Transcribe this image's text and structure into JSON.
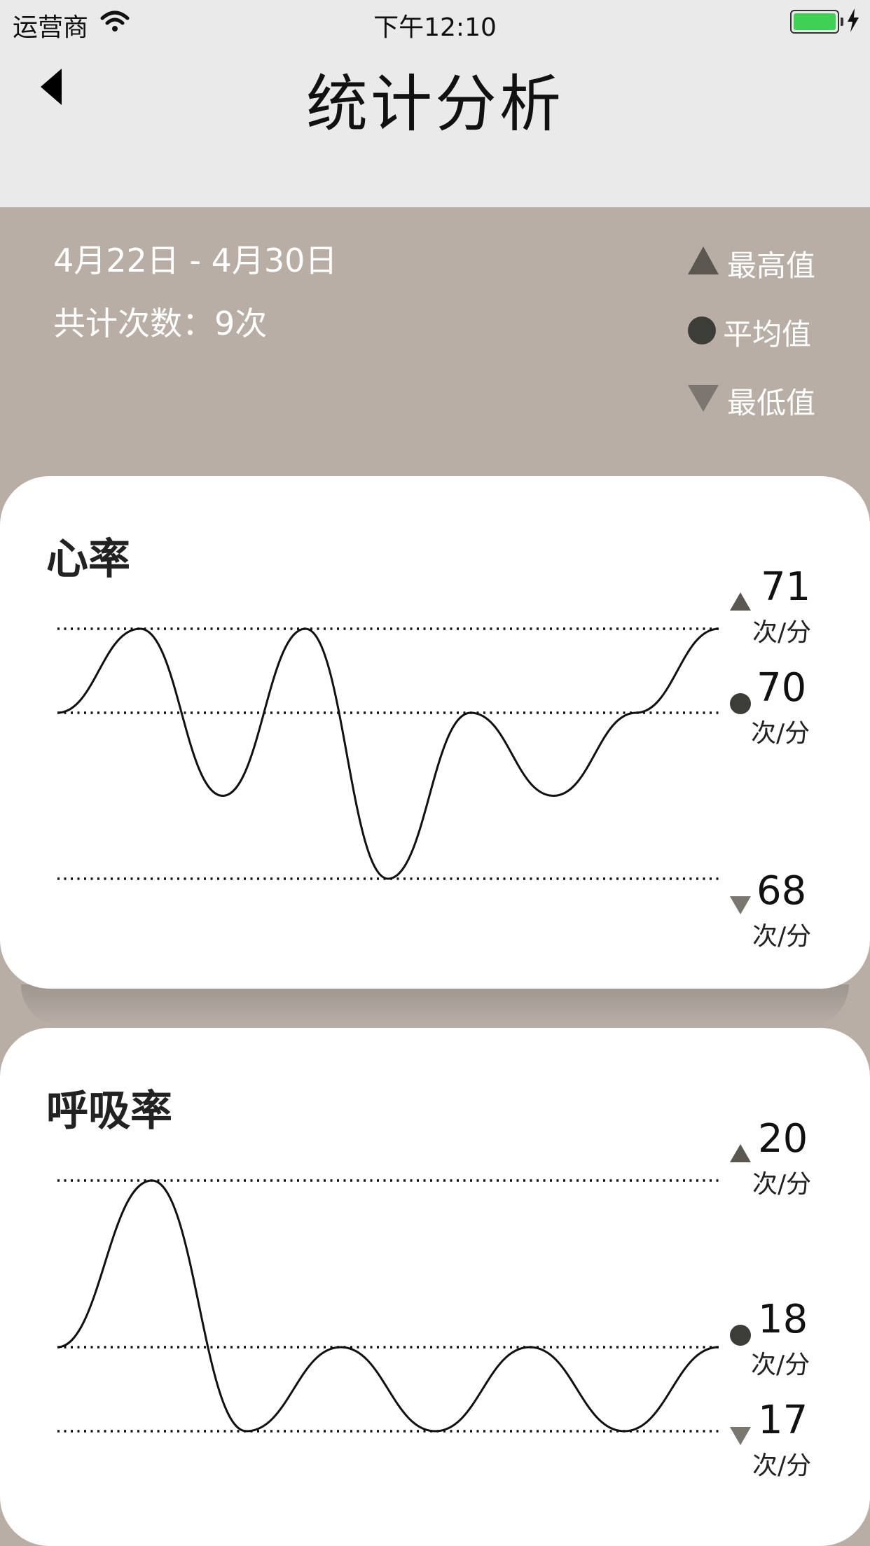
{
  "status_bar": {
    "carrier": "运营商",
    "time": "下午12:10",
    "battery_color": "#3fd155"
  },
  "nav": {
    "title": "统计分析",
    "back_icon": "back-arrow-icon"
  },
  "summary": {
    "date_range": "4月22日 - 4月30日",
    "total_count": "共计次数：9次",
    "legend": [
      {
        "icon": "triangle-up-icon",
        "label": "最高值"
      },
      {
        "icon": "circle-icon",
        "label": "平均值"
      },
      {
        "icon": "triangle-down-icon",
        "label": "最低值"
      }
    ]
  },
  "colors": {
    "background_band": "#b8aea6",
    "header": "#eaeaea",
    "marker_max": "#5a5751",
    "marker_avg": "#3c3c38",
    "marker_min": "#7a7670"
  },
  "cards": [
    {
      "title": "心率",
      "max": {
        "value": "71",
        "unit": "次/分"
      },
      "avg": {
        "value": "70",
        "unit": "次/分"
      },
      "min": {
        "value": "68",
        "unit": "次/分"
      }
    },
    {
      "title": "呼吸率",
      "max": {
        "value": "20",
        "unit": "次/分"
      },
      "avg": {
        "value": "18",
        "unit": "次/分"
      },
      "min": {
        "value": "17",
        "unit": "次/分"
      }
    }
  ],
  "chart_data": [
    {
      "type": "line",
      "title": "心率",
      "reference_lines": {
        "max": 71,
        "avg": 70,
        "min": 68
      },
      "series": [
        {
          "values": [
            70,
            71,
            69,
            71,
            68,
            70,
            69,
            70,
            71
          ]
        }
      ]
    },
    {
      "type": "line",
      "title": "呼吸率",
      "reference_lines": {
        "max": 20,
        "avg": 18,
        "min": 17
      },
      "series": [
        {
          "values": [
            18,
            20,
            17,
            18,
            17,
            18,
            17,
            18
          ]
        }
      ]
    }
  ]
}
